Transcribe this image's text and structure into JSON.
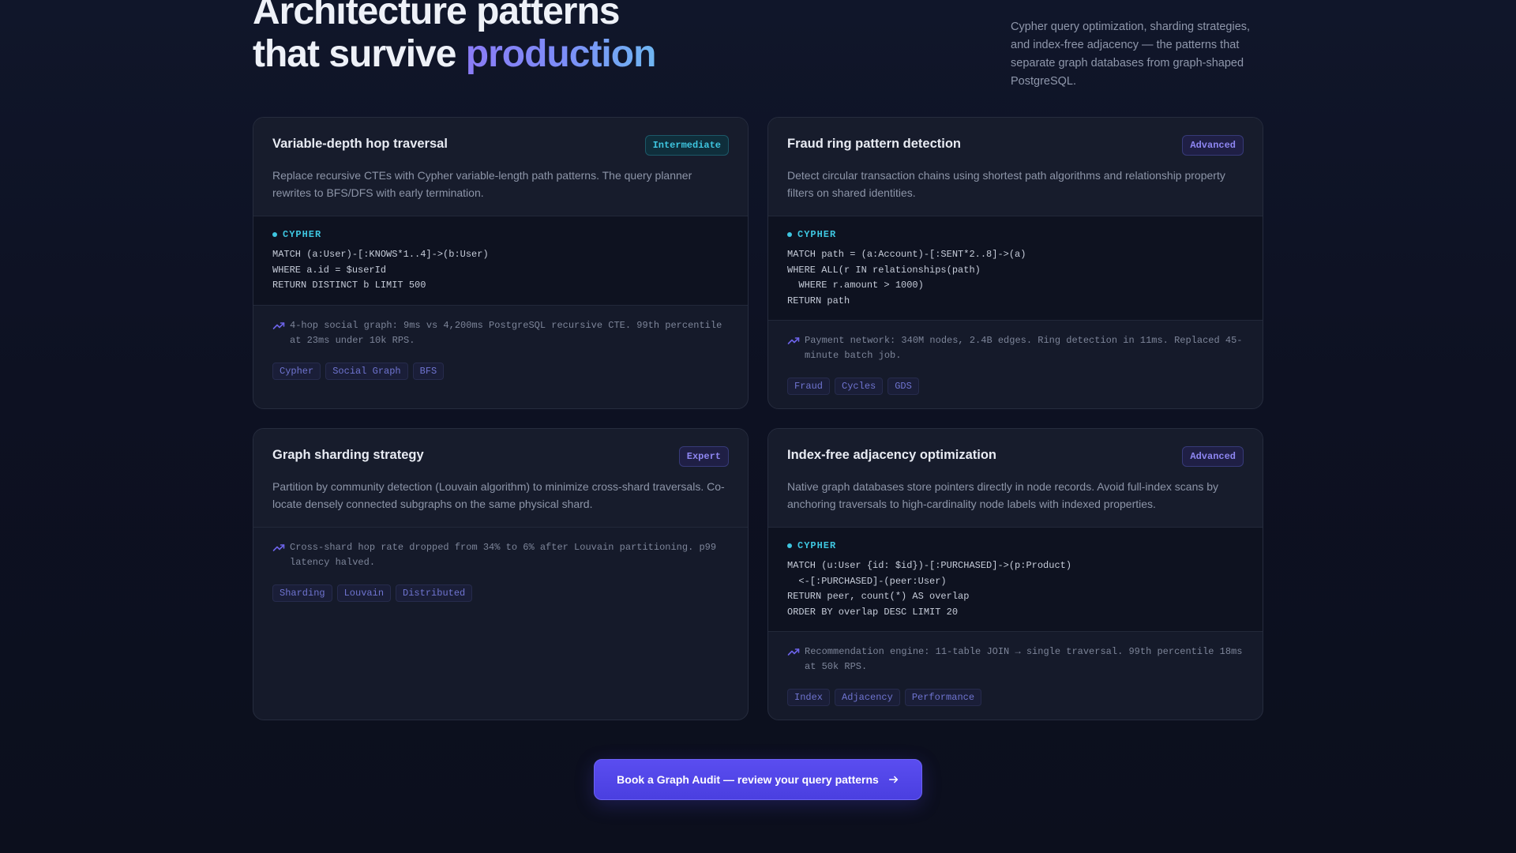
{
  "hero": {
    "title_line1": "Architecture patterns",
    "title_line2_prefix": "that survive ",
    "title_line2_highlight": "production",
    "description": "Cypher query optimization, sharding strategies, and index-free adjacency — the patterns that separate graph databases from graph-shaped PostgreSQL."
  },
  "cards": [
    {
      "title": "Variable-depth hop traversal",
      "level": "Intermediate",
      "description": "Replace recursive CTEs with Cypher variable-length path patterns. The query planner rewrites to BFS/DFS with early termination.",
      "code_lang": "CYPHER",
      "code": [
        "MATCH (a:User)-[:KNOWS*1..4]->(b:User)",
        "WHERE a.id = $userId",
        "RETURN DISTINCT b LIMIT 500"
      ],
      "metric_icon": "trending-up-icon",
      "metric": "4-hop social graph: 9ms vs 4,200ms PostgreSQL recursive CTE. 99th percentile at 23ms under 10k RPS.",
      "tags": [
        "Cypher",
        "Social Graph",
        "BFS"
      ]
    },
    {
      "title": "Fraud ring pattern detection",
      "level": "Advanced",
      "description": "Detect circular transaction chains using shortest path algorithms and relationship property filters on shared identities.",
      "code_lang": "CYPHER",
      "code": [
        "MATCH path = (a:Account)-[:SENT*2..8]->(a)",
        "WHERE ALL(r IN relationships(path)",
        "  WHERE r.amount > 1000)",
        "RETURN path"
      ],
      "metric_icon": "trending-up-icon",
      "metric": "Payment network: 340M nodes, 2.4B edges. Ring detection in 11ms. Replaced 45-minute batch job.",
      "tags": [
        "Fraud",
        "Cycles",
        "GDS"
      ]
    },
    {
      "title": "Graph sharding strategy",
      "level": "Expert",
      "description": "Partition by community detection (Louvain algorithm) to minimize cross-shard traversals. Co-locate densely connected subgraphs on the same physical shard.",
      "metric_icon": "trending-up-icon",
      "metric": "Cross-shard hop rate dropped from 34% to 6% after Louvain partitioning. p99 latency halved.",
      "tags": [
        "Sharding",
        "Louvain",
        "Distributed"
      ]
    },
    {
      "title": "Index-free adjacency optimization",
      "level": "Advanced",
      "description": "Native graph databases store pointers directly in node records. Avoid full-index scans by anchoring traversals to high-cardinality node labels with indexed properties.",
      "code_lang": "CYPHER",
      "code": [
        "MATCH (u:User {id: $id})-[:PURCHASED]->(p:Product)",
        "  <-[:PURCHASED]-(peer:User)",
        "RETURN peer, count(*) AS overlap",
        "ORDER BY overlap DESC LIMIT 20"
      ],
      "metric_icon": "trending-up-icon",
      "metric": "Recommendation engine: 11-table JOIN → single traversal. 99th percentile 18ms at 50k RPS.",
      "tags": [
        "Index",
        "Adjacency",
        "Performance"
      ]
    }
  ],
  "cta": {
    "label": "Book a Graph Audit — review your query patterns",
    "icon": "arrow-right-icon"
  },
  "colors": {
    "accent_cyan": "#3ec6e0",
    "accent_indigo": "#5a4df0",
    "tag_text": "#6f74d0"
  }
}
